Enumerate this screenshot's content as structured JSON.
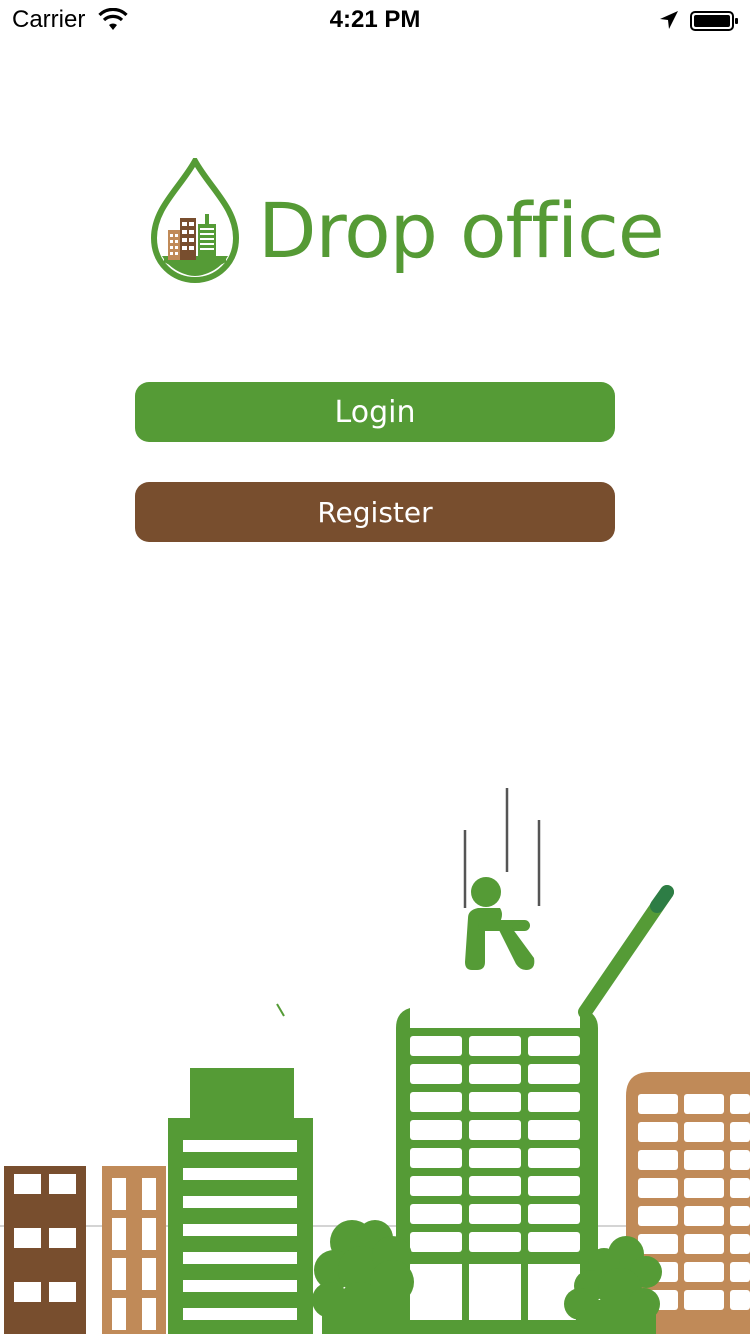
{
  "status_bar": {
    "carrier": "Carrier",
    "time": "4:21 PM",
    "icons": [
      "wifi-icon",
      "location-arrow-icon",
      "battery-icon"
    ]
  },
  "logo": {
    "text": "Drop office",
    "icon": "water-drop-buildings-icon"
  },
  "buttons": {
    "login": "Login",
    "register": "Register"
  },
  "colors": {
    "green": "#559b36",
    "brown": "#784e2e",
    "tan": "#bf8a58"
  },
  "illustration": "city-skyline-with-sitting-person"
}
